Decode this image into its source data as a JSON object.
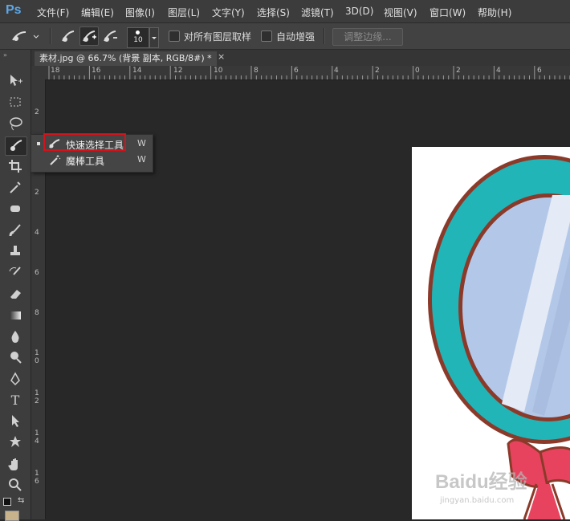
{
  "app": {
    "logo": "Ps"
  },
  "menubar": {
    "items": [
      "文件(F)",
      "编辑(E)",
      "图像(I)",
      "图层(L)",
      "文字(Y)",
      "选择(S)",
      "滤镜(T)",
      "3D(D)",
      "视图(V)",
      "窗口(W)",
      "帮助(H)"
    ]
  },
  "options": {
    "brush_size": "10",
    "sample_all_layers_label": "对所有图层取样",
    "auto_enhance_label": "自动增强",
    "refine_edge_label": "调整边缘..."
  },
  "document": {
    "tab_title": "素材.jpg @ 66.7% (背景 副本, RGB/8#) *",
    "close_symbol": "×"
  },
  "rulers": {
    "horizontal": [
      "18",
      "16",
      "14",
      "12",
      "10",
      "8",
      "6",
      "4",
      "2",
      "0",
      "2",
      "4",
      "6"
    ],
    "vertical": [
      "2",
      "2",
      "4",
      "6",
      "8",
      "1\n0",
      "1\n2",
      "1\n4",
      "1\n6"
    ]
  },
  "flyout": {
    "items": [
      {
        "label": "快速选择工具",
        "shortcut": "W",
        "icon": "quick-selection-icon",
        "selected": true
      },
      {
        "label": "魔棒工具",
        "shortcut": "W",
        "icon": "magic-wand-icon",
        "selected": false
      }
    ]
  },
  "colors": {
    "accent_highlight": "#d0141c",
    "mirror_frame": "#22b5b8",
    "mirror_border": "#8b3a2a",
    "mirror_glass": "#b3c8e8",
    "bow": "#e8435e",
    "ps_logo": "#5ea8e8"
  },
  "watermark": {
    "brand": "Baidu经验",
    "url": "jingyan.baidu.com"
  }
}
